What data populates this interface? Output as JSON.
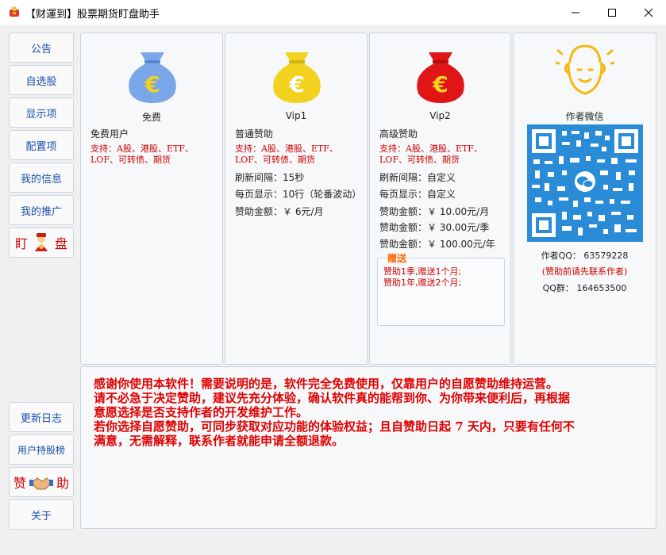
{
  "window": {
    "title": "【财運到】股票期货盯盘助手"
  },
  "sidebar": {
    "top_items": [
      {
        "label": "公告"
      },
      {
        "label": "自选股"
      },
      {
        "label": "显示项"
      },
      {
        "label": "配置项"
      },
      {
        "label": "我的信息"
      },
      {
        "label": "我的推广"
      }
    ],
    "watch_button": {
      "left": "盯",
      "right": "盘"
    },
    "bottom_items": [
      {
        "label": "更新日志"
      },
      {
        "label": "用户持股榜"
      }
    ],
    "donate_button": {
      "left": "赞",
      "right": "助"
    },
    "about_label": "关于"
  },
  "tiers": [
    {
      "name": "免费",
      "type_label": "免费用户",
      "support": [
        "支持：A股、港股、ETF、",
        "LOF、可转债、期货"
      ],
      "bag_color": "#7aa7e8"
    },
    {
      "name": "Vip1",
      "type_label": "普通赞助",
      "support": [
        "支持：A股、港股、ETF、",
        "LOF、可转债、期货"
      ],
      "refresh": "刷新间隔：15秒",
      "page_display": "每页显示：10行（轮番波动）",
      "amount": "赞助金额：￥ 6元/月",
      "bag_color": "#f2d21f"
    },
    {
      "name": "Vip2",
      "type_label": "高级赞助",
      "support": [
        "支持：A股、港股、ETF、",
        "LOF、可转债、期货"
      ],
      "refresh": "刷新间隔：自定义",
      "page_display": "每页显示：自定义",
      "amounts": [
        "赞助金额：￥ 10.00元/月",
        "赞助金额：￥ 30.00元/季",
        "赞助金额：￥ 100.00元/年"
      ],
      "gift": {
        "label": "赠送",
        "lines": [
          "赞助1季,赠送1个月;",
          "赞助1年,赠送2个月;"
        ]
      },
      "bag_color": "#e01515"
    }
  ],
  "author": {
    "title": "作者微信",
    "qq": "作者QQ： 63579228",
    "note": "(赞助前请先联系作者)",
    "group": "QQ群： 164653500"
  },
  "notice": {
    "lines": [
      "感谢你使用本软件！需要说明的是，软件完全免费使用，仅靠用户的自愿赞助维持运营。",
      "请不必急于决定赞助，建议先充分体验，确认软件真的能帮到你、为你带来便利后，再根据",
      "意愿选择是否支持作者的开发维护工作。",
      "若你选择自愿赞助，可同步获取对应功能的体验权益；且自赞助日起 7 天内，只要有任何不",
      "满意，无需解释，联系作者就能申请全额退款。"
    ]
  },
  "colors": {
    "accent_blue": "#1a4fa8",
    "accent_red": "#d40000",
    "qr_blue": "#2a8bd6",
    "gift_orange": "#ff6600"
  }
}
